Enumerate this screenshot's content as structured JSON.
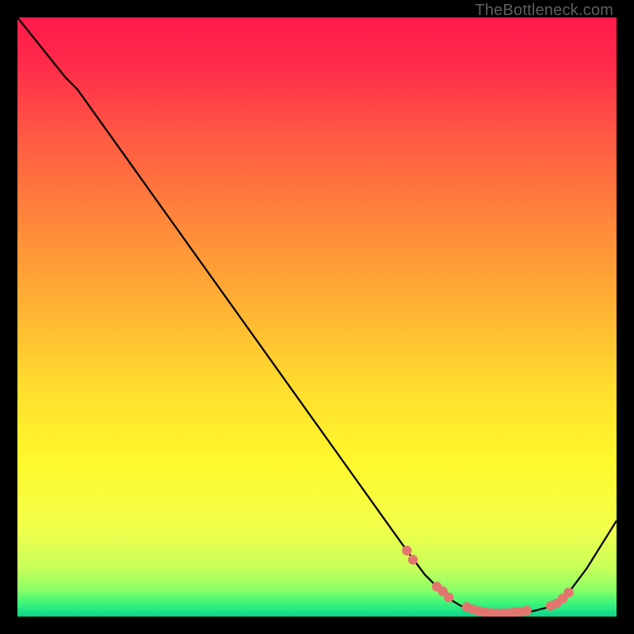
{
  "watermark": "TheBottleneck.com",
  "chart_data": {
    "type": "line",
    "title": "",
    "xlabel": "",
    "ylabel": "",
    "xlim": [
      0,
      100
    ],
    "ylim": [
      0,
      100
    ],
    "grid": false,
    "curve": {
      "name": "bottleneck-curve",
      "x": [
        0,
        8,
        10,
        15,
        20,
        25,
        30,
        35,
        40,
        45,
        50,
        55,
        60,
        65,
        68,
        70,
        72,
        74,
        76,
        78,
        80,
        82,
        84,
        86,
        88,
        90,
        92,
        95,
        100
      ],
      "y": [
        100,
        90,
        88,
        81,
        74,
        67,
        60,
        53,
        46,
        39,
        32,
        25,
        18,
        11,
        7,
        5,
        3,
        1.8,
        1.0,
        0.6,
        0.5,
        0.5,
        0.6,
        0.9,
        1.4,
        2,
        4,
        8,
        16
      ]
    },
    "markers": {
      "name": "sweet-spot-points",
      "x": [
        65,
        66,
        70,
        71,
        72,
        75,
        76,
        77,
        78,
        79,
        80,
        81,
        82,
        83,
        84,
        85,
        89,
        90,
        91,
        92
      ],
      "y": [
        11,
        9.5,
        5,
        4.2,
        3.2,
        1.6,
        1.2,
        0.9,
        0.7,
        0.6,
        0.55,
        0.55,
        0.6,
        0.7,
        0.8,
        1.0,
        1.8,
        2.2,
        3.0,
        4.0
      ]
    },
    "gradient_stops": [
      {
        "offset": 0.0,
        "color": "#ff1a4b"
      },
      {
        "offset": 0.08,
        "color": "#ff2b4a"
      },
      {
        "offset": 0.2,
        "color": "#ff5a43"
      },
      {
        "offset": 0.35,
        "color": "#ff8a3a"
      },
      {
        "offset": 0.5,
        "color": "#ffb733"
      },
      {
        "offset": 0.62,
        "color": "#ffde2e"
      },
      {
        "offset": 0.74,
        "color": "#fff82c"
      },
      {
        "offset": 0.85,
        "color": "#f2ff4a"
      },
      {
        "offset": 0.92,
        "color": "#c7ff5a"
      },
      {
        "offset": 0.955,
        "color": "#8bff66"
      },
      {
        "offset": 0.975,
        "color": "#45f777"
      },
      {
        "offset": 0.99,
        "color": "#1de586"
      },
      {
        "offset": 1.0,
        "color": "#0fd08e"
      }
    ],
    "marker_color": "#e2766f",
    "line_color": "#000000"
  }
}
